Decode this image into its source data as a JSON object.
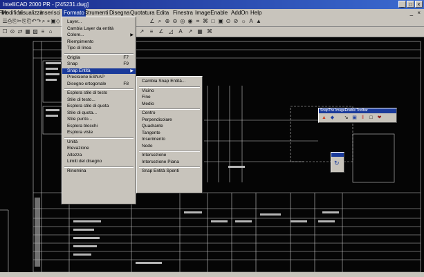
{
  "window": {
    "title": "IntelliCAD 2000 PR - [245231.dwg]",
    "buttons": [
      "_",
      "□",
      "×"
    ],
    "mdi_buttons": "_ ×"
  },
  "menubar": {
    "items": [
      "File",
      "Modifica",
      "Visualizza",
      "Inserisci",
      "Formato",
      "Strumenti",
      "Disegna",
      "Quotatura",
      "Edita",
      "Finestra",
      "ImageEnable",
      "AddOn",
      "Help"
    ],
    "open_item": "Formato"
  },
  "format_menu": {
    "items": [
      {
        "label": "Layer...",
        "shortcut": "",
        "submenu": false
      },
      {
        "label": "Cambia Layer da entità",
        "shortcut": "",
        "submenu": false
      },
      {
        "label": "Colore...",
        "shortcut": "",
        "submenu": true
      },
      {
        "label": "Riempimento",
        "shortcut": "",
        "submenu": false
      },
      {
        "label": "Tipo di linea",
        "shortcut": "",
        "submenu": false
      },
      {
        "sep": true
      },
      {
        "label": "Griglia",
        "shortcut": "F7",
        "submenu": false
      },
      {
        "label": "Snap",
        "shortcut": "F9",
        "submenu": false
      },
      {
        "label": "Snap Entità",
        "shortcut": "",
        "submenu": true,
        "highlighted": true
      },
      {
        "label": "Precisione ESNAP",
        "shortcut": "",
        "submenu": false
      },
      {
        "label": "Disegno ortogonale",
        "shortcut": "F8",
        "submenu": false
      },
      {
        "sep": true
      },
      {
        "label": "Esplora stile di testo",
        "shortcut": "",
        "submenu": false
      },
      {
        "label": "Stile di testo...",
        "shortcut": "",
        "submenu": false
      },
      {
        "label": "Esplora stile di quota",
        "shortcut": "",
        "submenu": false
      },
      {
        "label": "Stile di quota...",
        "shortcut": "",
        "submenu": false
      },
      {
        "label": "Stile punto...",
        "shortcut": "",
        "submenu": false
      },
      {
        "label": "Esplora blocchi",
        "shortcut": "",
        "submenu": false
      },
      {
        "label": "Esplora viste",
        "shortcut": "",
        "submenu": false
      },
      {
        "sep": true
      },
      {
        "label": "Unità",
        "shortcut": "",
        "submenu": false
      },
      {
        "label": "Elevazione",
        "shortcut": "",
        "submenu": false
      },
      {
        "label": "Altezza",
        "shortcut": "",
        "submenu": false
      },
      {
        "label": "Limiti del disegno",
        "shortcut": "",
        "submenu": false
      },
      {
        "sep": true
      },
      {
        "label": "Rinomina",
        "shortcut": "",
        "submenu": false
      }
    ]
  },
  "snap_submenu": {
    "items": [
      {
        "label": "Cambia Snap Entità..."
      },
      {
        "sep": true
      },
      {
        "label": "Vicino"
      },
      {
        "label": "Fine"
      },
      {
        "label": "Medio"
      },
      {
        "sep": true
      },
      {
        "label": "Centro"
      },
      {
        "label": "Perpendicolare"
      },
      {
        "label": "Quadrante"
      },
      {
        "label": "Tangente"
      },
      {
        "label": "Inserimento"
      },
      {
        "label": "Nodo"
      },
      {
        "sep": true
      },
      {
        "label": "Intersezione"
      },
      {
        "label": "Intersezione Piana"
      },
      {
        "sep": true
      },
      {
        "label": "Snap Entità Spenti"
      }
    ]
  },
  "floating_toolbar": {
    "title": "SnapThe ImageEnable Toolbar"
  },
  "toolbar1_icons": [
    "☰",
    "⎙",
    "⎘",
    "✂",
    "⎘",
    "⎗",
    "↶",
    "↷",
    "⌕",
    "⌖",
    "▣",
    "◇"
  ],
  "toolbar1_right_icons": [
    "∠",
    "⌕",
    "⊕",
    "⊖",
    "◎",
    "◉",
    "⌗",
    "⌘",
    "□",
    "▣",
    "⊙",
    "⊘",
    "☼",
    "A",
    "▲"
  ],
  "toolbar2_icons": [
    "☐",
    "⊙",
    "⇄",
    "▦",
    "▧",
    "≡",
    "⌂"
  ],
  "toolbar2_right_icons": [
    "↗",
    "≡",
    "∠",
    "◿",
    "A",
    "↗",
    "▦",
    "⌘"
  ],
  "float_icons": [
    "▲",
    "◆",
    "↘",
    "▣",
    "‖",
    "□",
    "❤"
  ]
}
